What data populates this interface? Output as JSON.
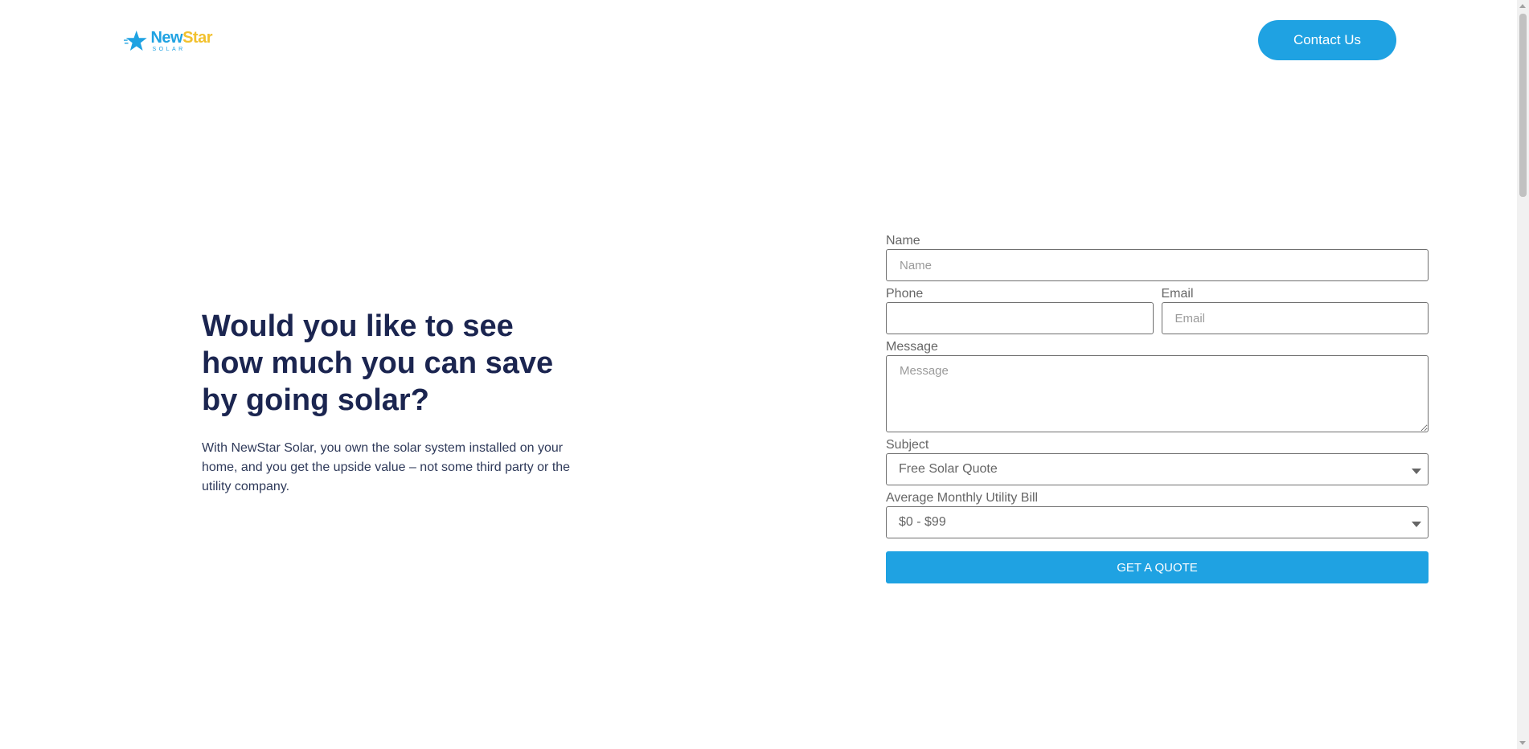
{
  "header": {
    "logo_word_1": "New",
    "logo_word_2": "Star",
    "logo_sub": "SOLAR",
    "contact_label": "Contact Us"
  },
  "hero": {
    "title": "Would you like to see how much you can save by going solar?",
    "text": "With NewStar Solar, you own the solar system installed on your home, and you get the upside value – not some third party or the utility company."
  },
  "form": {
    "name_label": "Name",
    "name_placeholder": "Name",
    "name_value": "",
    "phone_label": "Phone",
    "phone_value": "",
    "email_label": "Email",
    "email_placeholder": "Email",
    "email_value": "",
    "message_label": "Message",
    "message_placeholder": "Message",
    "subject_label": "Subject",
    "subject_value": "Free Solar Quote",
    "bill_label": "Average Monthly Utility Bill",
    "bill_value": "$0 - $99",
    "submit_label": "GET A QUOTE"
  },
  "colors": {
    "brand_blue": "#1fa2e2",
    "brand_yellow": "#f2c12e",
    "heading": "#1b2550"
  },
  "icons": {
    "logo": "star-icon",
    "select_caret": "caret-down-icon"
  }
}
